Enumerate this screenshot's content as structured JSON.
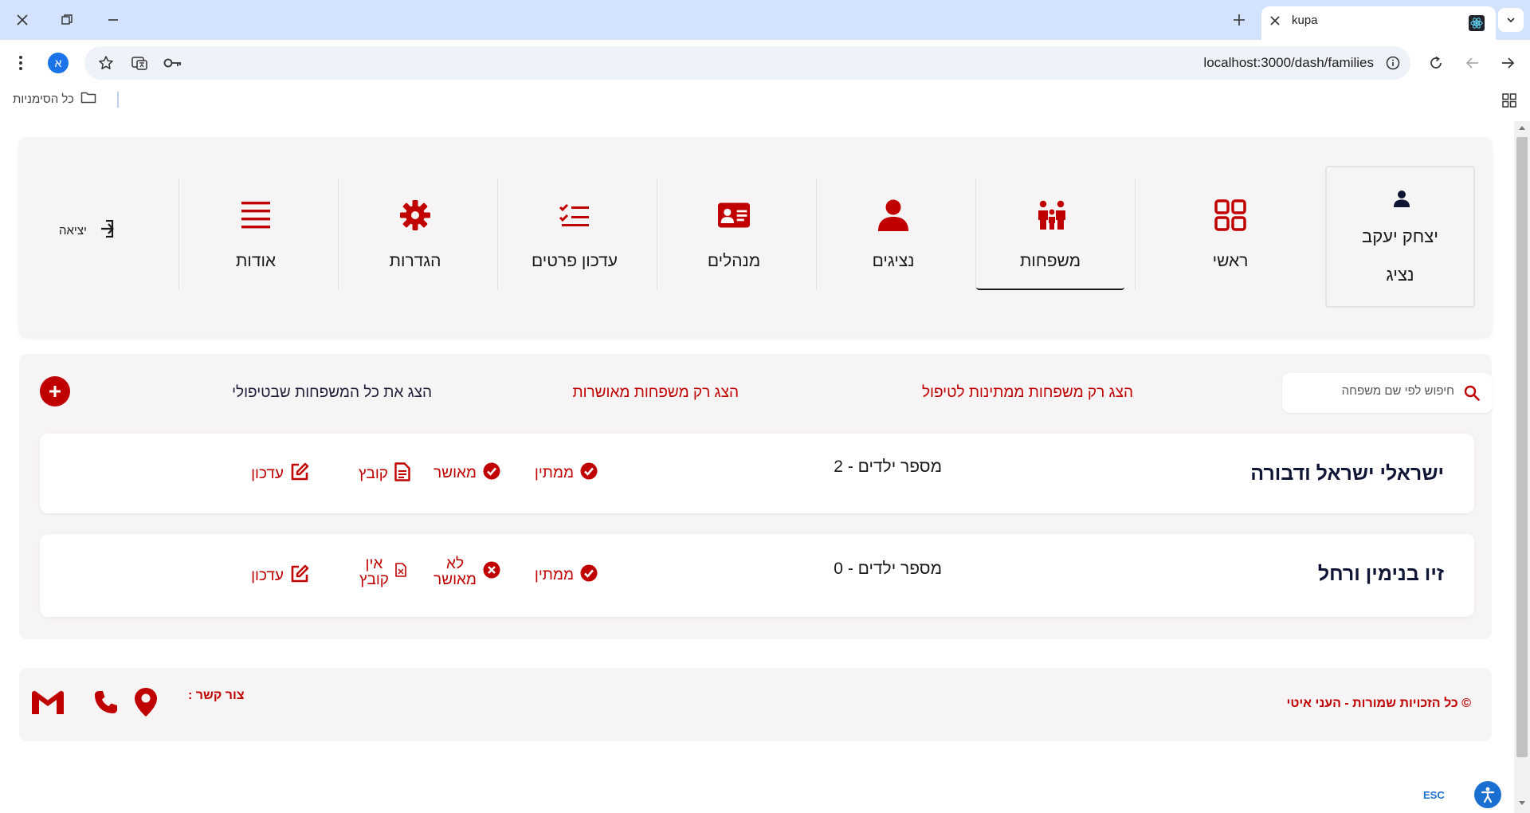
{
  "browser": {
    "tab_title": "kupa",
    "url": "localhost:3000/dash/families",
    "profile_initial": "א",
    "bookmarks_all": "כל הסימניות"
  },
  "colors": {
    "accent": "#c00000",
    "dark_text": "#0f1535",
    "card_bg": "#f7f4f5"
  },
  "user": {
    "name": "יצחק יעקב",
    "role": "נציג"
  },
  "nav": {
    "items": [
      {
        "label": "ראשי",
        "icon": "grid-icon"
      },
      {
        "label": "משפחות",
        "icon": "family-icon",
        "active": true
      },
      {
        "label": "נציגים",
        "icon": "person-icon"
      },
      {
        "label": "מנהלים",
        "icon": "id-card-icon"
      },
      {
        "label": "עדכון פרטים",
        "icon": "checklist-icon"
      },
      {
        "label": "הגדרות",
        "icon": "gear-icon"
      },
      {
        "label": "אודות",
        "icon": "menu-lines-icon"
      }
    ],
    "logout": "יציאה"
  },
  "families_list": {
    "search_placeholder": "חיפוש לפי שם משפחה",
    "filters": {
      "pending": "הצג רק משפחות ממתינות לטיפול",
      "approved": "הצג רק משפחות מאושרות",
      "mine": "הצג את כל המשפחות שבטיפולי"
    },
    "rows": [
      {
        "name": "ישראלי ישראל ודבורה",
        "kids": "מספר ילדים - 2",
        "waiting": "ממתין",
        "approval": "מאושר",
        "file": "קובץ",
        "edit": "עדכון"
      },
      {
        "name": "זיו בנימין ורחל",
        "kids": "מספר ילדים - 0",
        "waiting": "ממתין",
        "approval_l1": "לא",
        "approval_l2": "מאושר",
        "file_l1": "אין",
        "file_l2": "קובץ",
        "edit": "עדכון"
      }
    ]
  },
  "footer": {
    "copyright": "כל הזכויות שמורות - העני איטי",
    "contact_label": "צור קשר :"
  },
  "overlay": {
    "esc_label": "ESC"
  }
}
